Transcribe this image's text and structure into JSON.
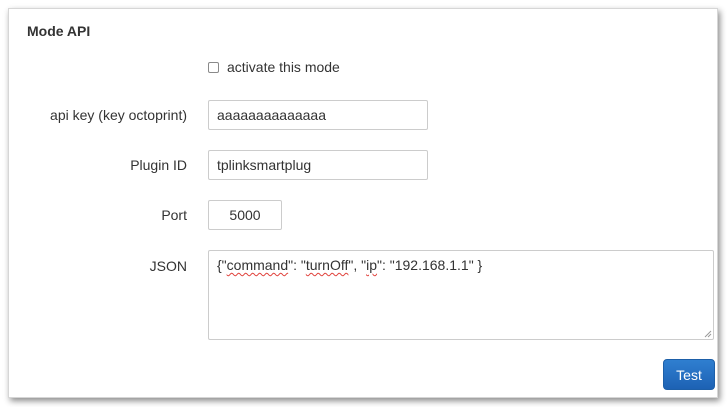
{
  "panel": {
    "title": "Mode API"
  },
  "activate": {
    "label": "activate this mode",
    "checked": false
  },
  "fields": {
    "api_key": {
      "label": "api key (key octoprint)",
      "value": "aaaaaaaaaaaaaa"
    },
    "plugin_id": {
      "label": "Plugin ID",
      "value": "tplinksmartplug"
    },
    "port": {
      "label": "Port",
      "value": "5000"
    },
    "json": {
      "label": "JSON",
      "value": "{\"command\": \"turnOff\", \"ip\": \"192.168.1.1\" }",
      "parts": {
        "p1": "{\"",
        "p2": "command",
        "p3": "\": \"",
        "p4": "turnOff",
        "p5": "\", \"",
        "p6": "ip",
        "p7": "\": \"192.168.1.1\" }"
      }
    }
  },
  "buttons": {
    "test_label": "Test"
  },
  "colors": {
    "button_primary": "#1d62b4",
    "spellcheck_underline": "#e0403a"
  }
}
